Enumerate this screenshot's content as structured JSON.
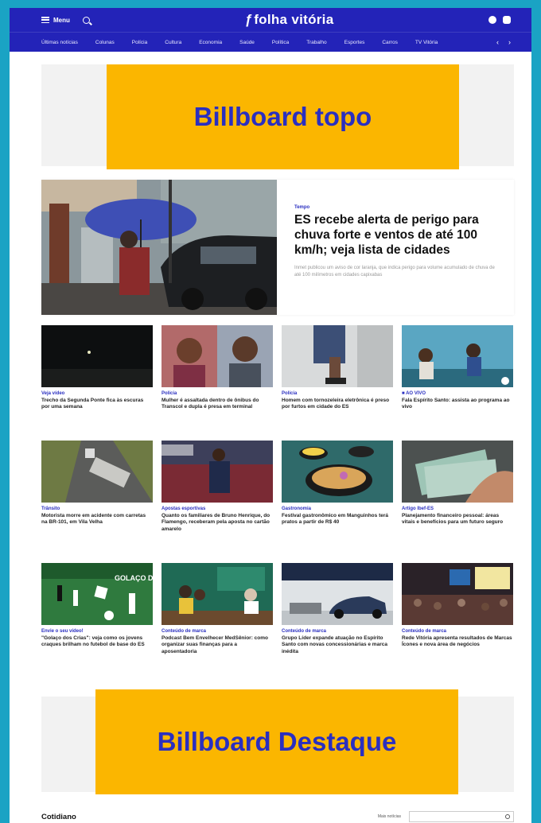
{
  "header": {
    "menu_label": "Menu",
    "logo_text": "folha vitória",
    "brand_color": "#2323b8",
    "accent_color": "#fbb600"
  },
  "nav": {
    "items": [
      "Últimas notícias",
      "Colunas",
      "Polícia",
      "Cultura",
      "Economia",
      "Saúde",
      "Política",
      "Trabalho",
      "Esportes",
      "Carros",
      "TV Vitória"
    ]
  },
  "billboards": {
    "top": "Billboard topo",
    "destaque": "Billboard Destaque"
  },
  "hero": {
    "kicker": "Tempo",
    "title": "ES recebe alerta de perigo para chuva forte e ventos de até 100 km/h; veja lista de cidades",
    "subtitle": "Inmet publicou um aviso de cor laranja, que indica perigo para volume acumulado de chuva de até 100 milímetros em cidades capixabas"
  },
  "cards": [
    {
      "cat": "Veja vídeo",
      "title": "Trecho da Segunda Ponte fica às escuras por uma semana"
    },
    {
      "cat": "Polícia",
      "title": "Mulher é assaltada dentro de ônibus do Transcol e dupla é presa em terminal"
    },
    {
      "cat": "Polícia",
      "title": "Homem com tornozeleira eletrônica é preso por furtos em cidade do ES"
    },
    {
      "cat": "■ AO VIVO",
      "title": "Fala Espírito Santo: assista ao programa ao vivo"
    },
    {
      "cat": "Trânsito",
      "title": "Motorista morre em acidente com carretas na BR-101, em Vila Velha"
    },
    {
      "cat": "Apostas esportivas",
      "title": "Quanto os familiares de Bruno Henrique, do Flamengo, receberam pela aposta no cartão amarelo"
    },
    {
      "cat": "Gastronomia",
      "title": "Festival gastronômico em Manguinhos terá pratos a partir de R$ 40"
    },
    {
      "cat": "Artigo Ibef-ES",
      "title": "Planejamento financeiro pessoal: áreas vitais e benefícios para um futuro seguro"
    },
    {
      "cat": "Envie o seu vídeo!",
      "title": "\"Golaço dos Crias\": veja como os jovens craques brilham no futebol de base do ES"
    },
    {
      "cat": "Conteúdo de marca",
      "title": "Podcast Bem Envelhecer MedSênior: como organizar suas finanças para a aposentadoria"
    },
    {
      "cat": "Conteúdo de marca",
      "title": "Grupo Líder expande atuação no Espírito Santo com novas concessionárias e marca inédita"
    },
    {
      "cat": "Conteúdo de marca",
      "title": "Rede Vitória apresenta resultados de Marcas Ícones e nova área de negócios"
    }
  ],
  "card_thumb_text": {
    "golaco": "GOLAÇO DOS CRIAS"
  },
  "bottom": {
    "section": "Cotidiano",
    "more_label": "Mais notícias"
  }
}
